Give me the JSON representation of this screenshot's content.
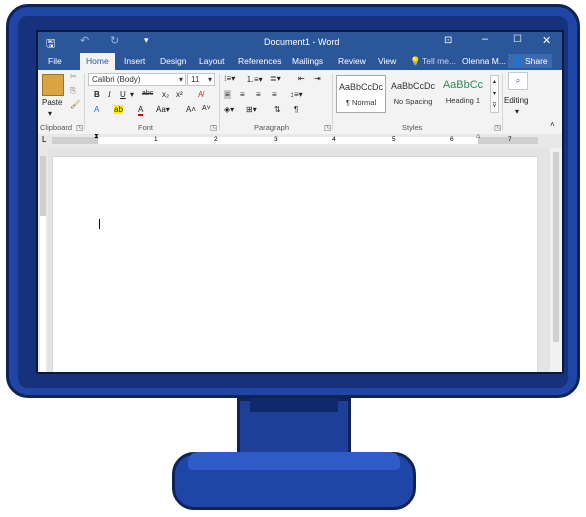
{
  "window": {
    "title": "Document1 - Word",
    "user": "Olenna M...",
    "share": "Share"
  },
  "tabs": [
    "File",
    "Home",
    "Insert",
    "Design",
    "Layout",
    "References",
    "Mailings",
    "Review",
    "View"
  ],
  "tell_me": "Tell me...",
  "ribbon": {
    "clipboard": {
      "paste": "Paste",
      "label": "Clipboard"
    },
    "font": {
      "family": "Calibri (Body)",
      "size": "11",
      "label": "Font"
    },
    "paragraph": {
      "label": "Paragraph"
    },
    "styles": {
      "label": "Styles",
      "items": [
        {
          "preview": "AaBbCcDc",
          "name": "¶ Normal"
        },
        {
          "preview": "AaBbCcDc",
          "name": "No Spacing"
        },
        {
          "preview": "AaBbCc",
          "name": "Heading 1"
        }
      ]
    },
    "editing": {
      "label": "Editing"
    }
  },
  "ruler_ticks": [
    "1",
    "2",
    "3",
    "4",
    "5",
    "6",
    "7"
  ],
  "colors": {
    "word_blue": "#2b579a",
    "bezel": "#1f45a6",
    "bezel_dark": "#0f2357"
  }
}
